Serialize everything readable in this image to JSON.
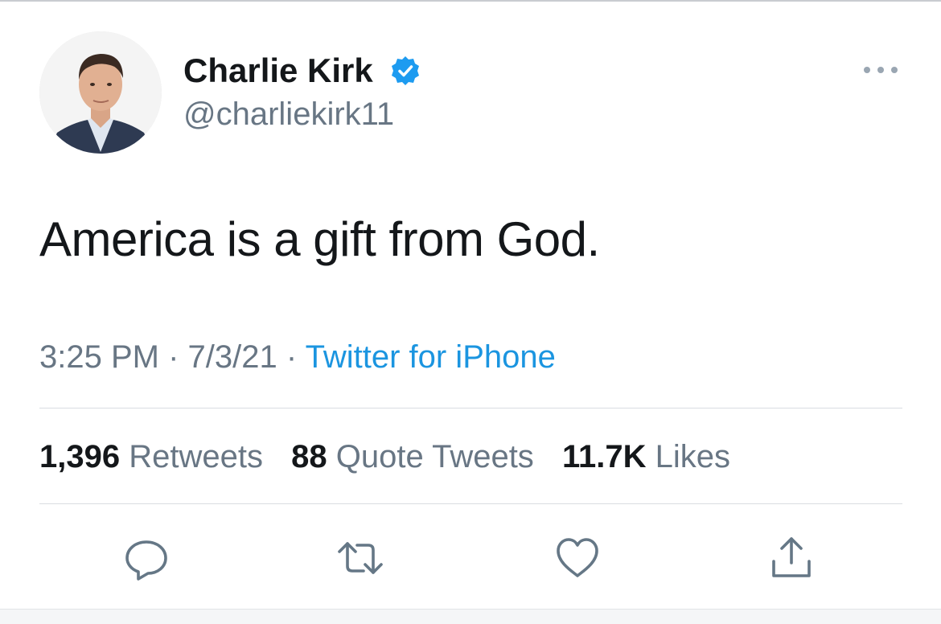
{
  "author": {
    "display_name": "Charlie Kirk",
    "handle": "@charliekirk11",
    "verified": true,
    "avatar_icon": "profile-photo"
  },
  "tweet": {
    "text": "America is a gift from God.",
    "time": "3:25 PM",
    "date": "7/3/21",
    "separator": "·",
    "source": "Twitter for iPhone"
  },
  "stats": {
    "retweets": {
      "count": "1,396",
      "label": "Retweets"
    },
    "quote_tweets": {
      "count": "88",
      "label": "Quote Tweets"
    },
    "likes": {
      "count": "11.7K",
      "label": "Likes"
    }
  },
  "actions": [
    "reply-icon",
    "retweet-icon",
    "like-icon",
    "share-icon"
  ],
  "colors": {
    "text": "#14171a",
    "secondary": "#687684",
    "accent": "#1b95e0",
    "verified": "#1d9bf0",
    "divider": "#d9dde1"
  }
}
